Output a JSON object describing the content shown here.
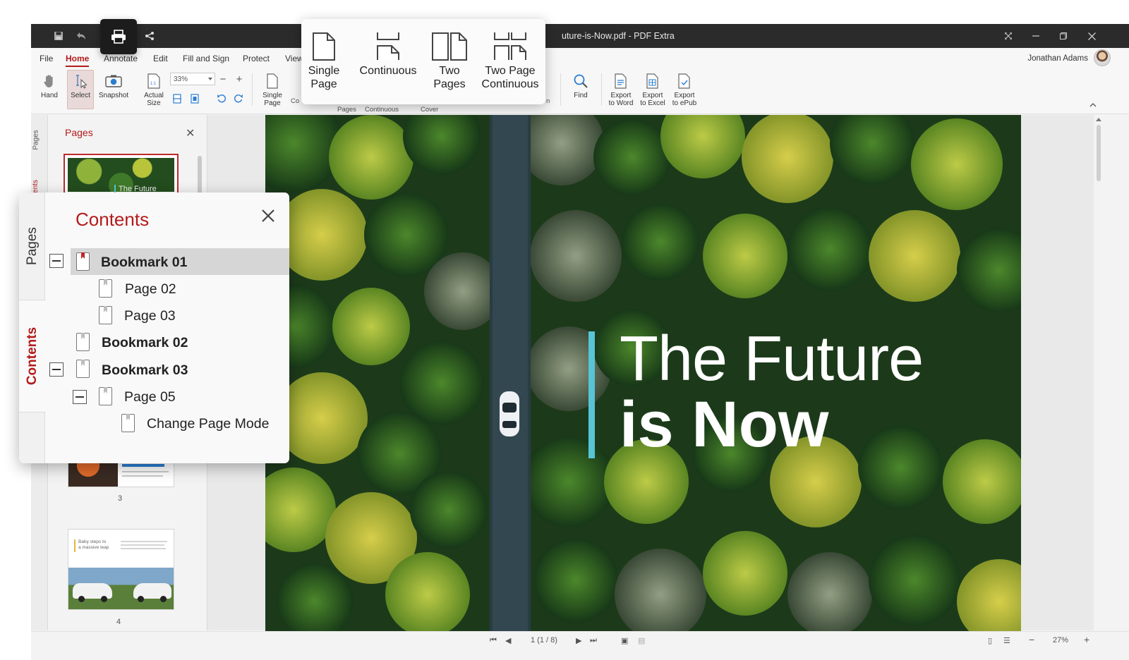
{
  "window": {
    "title": "uture-is-Now.pdf - PDF Extra"
  },
  "menu": {
    "tabs": [
      "File",
      "Home",
      "Annotate",
      "Edit",
      "Fill and Sign",
      "Protect",
      "View"
    ],
    "active": "Home"
  },
  "user": {
    "name": "Jonathan Adams"
  },
  "ribbon": {
    "hand": "Hand",
    "select": "Select",
    "snapshot": "Snapshot",
    "actual_size": [
      "Actual",
      "Size"
    ],
    "zoom_value": "33%",
    "single_page": [
      "Single",
      "Page"
    ],
    "cut_label_co": "Co",
    "cut_label_pages": "Pages",
    "cut_label_continuous": "Continuous",
    "cut_label_cover": "Cover",
    "cut_label_n": "n",
    "find": "Find",
    "export_word": [
      "Export",
      "to Word"
    ],
    "export_excel": [
      "Export",
      "to Excel"
    ],
    "export_epub": [
      "Export",
      "to ePub"
    ]
  },
  "page_mode_popup": {
    "items": [
      [
        "Single",
        "Page"
      ],
      [
        "Continuous"
      ],
      [
        "Two",
        "Pages"
      ],
      [
        "Two Page",
        "Continuous"
      ]
    ]
  },
  "side_strip": {
    "pages": "Pages",
    "contents": "ents"
  },
  "pages_panel": {
    "title": "Pages",
    "thumb1_text": "The Future",
    "thumb_numbers": [
      "3",
      "4"
    ],
    "thumb4_text": [
      "Baby steps to",
      "a massive leap"
    ]
  },
  "contents_popup": {
    "title": "Contents",
    "tab_pages": "Pages",
    "tab_contents": "Contents",
    "items": [
      {
        "label": "Bookmark 01",
        "bold": true,
        "expanded": true,
        "selected": true
      },
      {
        "label": "Page 02",
        "bold": false
      },
      {
        "label": "Page 03",
        "bold": false
      },
      {
        "label": "Bookmark 02",
        "bold": true
      },
      {
        "label": "Bookmark 03",
        "bold": true,
        "expanded": true
      },
      {
        "label": "Page 05",
        "bold": false,
        "expanded": true
      },
      {
        "label": "Change Page Mode",
        "bold": false
      }
    ]
  },
  "document": {
    "headline_line1": "The Future",
    "headline_line2": "is Now",
    "accent_color": "#58c4d6"
  },
  "statusbar": {
    "page_indicator": "1 (1 / 8)",
    "zoom": "27%"
  },
  "colors": {
    "brand_red": "#b31b1b",
    "titlebar": "#2b2b2b"
  }
}
